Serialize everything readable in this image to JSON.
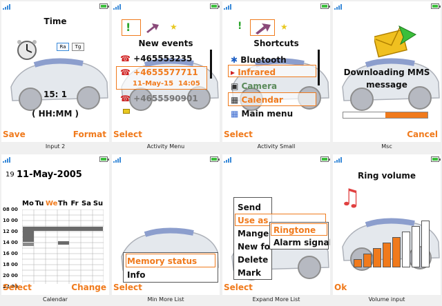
{
  "colors": {
    "accent": "#f07a1c",
    "signal": "#3a8ad8",
    "battery": "#3bbf3b",
    "text": "#111111"
  },
  "screens": [
    {
      "id": "input2",
      "caption": "Input 2",
      "title": "Time",
      "buttons": [
        "Ra",
        "Tg"
      ],
      "time_value": "15: 1",
      "time_format": "( HH:MM )",
      "softkeys": {
        "left": "Save",
        "right": "Format"
      }
    },
    {
      "id": "activity-menu",
      "caption": "Activity Menu",
      "title": "New events",
      "items": [
        "+465553235",
        "+4655577711",
        "11-May-15",
        "14:05",
        "+4655590901"
      ],
      "softkeys": {
        "left": "Select",
        "right": ""
      }
    },
    {
      "id": "activity-small",
      "caption": "Activity Small",
      "title": "Shortcuts",
      "items": [
        "Bluetooth",
        "Infrared",
        "Camera",
        "Calendar",
        "Main menu"
      ],
      "softkeys": {
        "left": "Select",
        "right": ""
      }
    },
    {
      "id": "msc",
      "caption": "Msc",
      "message_line1": "Downloading MMS",
      "message_line2": "message",
      "progress": 0.5,
      "softkeys": {
        "left": "",
        "right": "Cancel"
      }
    },
    {
      "id": "calendar",
      "caption": "Calendar",
      "week": "19",
      "date": "11-May-2005",
      "days": [
        "Mo",
        "Tu",
        "We",
        "Th",
        "Fr",
        "Sa",
        "Su"
      ],
      "hours": [
        "08 00",
        "10 00",
        "12 00",
        "14 00",
        "16 00",
        "18 00",
        "20 00",
        "22 00"
      ],
      "softkeys": {
        "left": "Select",
        "right": "Change"
      }
    },
    {
      "id": "min-more-list",
      "caption": "Min More List",
      "items": [
        "Memory status",
        "Info"
      ],
      "softkeys": {
        "left": "Select",
        "right": ""
      }
    },
    {
      "id": "expand-more-list",
      "caption": "Expand More List",
      "items": [
        "Send",
        "Use as",
        "Mange fi",
        "New fol",
        "Delete",
        "Mark"
      ],
      "submenu": [
        "Ringtone",
        "Alarm signal"
      ],
      "softkeys": {
        "left": "Select",
        "right": ""
      }
    },
    {
      "id": "volume-input",
      "caption": "Volume input",
      "title": "Ring volume",
      "volume_level": 0.625,
      "softkeys": {
        "left": "Ok",
        "right": ""
      }
    }
  ]
}
